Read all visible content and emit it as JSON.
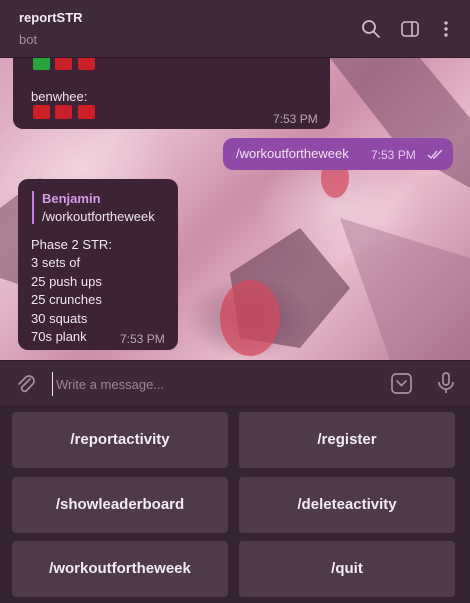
{
  "header": {
    "title": "reportSTR",
    "subtitle": "bot",
    "icons": [
      "search-icon",
      "sidebar-toggle-icon",
      "more-vertical-icon"
    ]
  },
  "messages": {
    "first": {
      "name_line": "benwhee:",
      "time": "7:53 PM"
    },
    "command": {
      "text": "/workoutfortheweek",
      "time": "7:53 PM",
      "status": "read"
    },
    "reply": {
      "quoted_sender": "Benjamin",
      "quoted_text": "/workoutfortheweek",
      "body": "Phase 2 STR:\n3 sets of\n25 push ups\n25 crunches\n30 squats\n70s plank",
      "time": "7:53 PM"
    }
  },
  "composer": {
    "placeholder": "Write a message...",
    "icons": [
      "attach-icon",
      "keyboard-toggle-icon",
      "microphone-icon"
    ]
  },
  "keyboard": {
    "buttons": [
      "/reportactivity",
      "/register",
      "/showleaderboard",
      "/deleteactivity",
      "/workoutfortheweek",
      "/quit"
    ]
  },
  "colors": {
    "header_bg": "#3f2a3c",
    "incoming_bubble": "#3c2336",
    "outgoing_bubble": "#8e4aa6",
    "key_bg": "#4e3a4b",
    "status_red": "#cc1f26",
    "status_green": "#26a63a"
  }
}
